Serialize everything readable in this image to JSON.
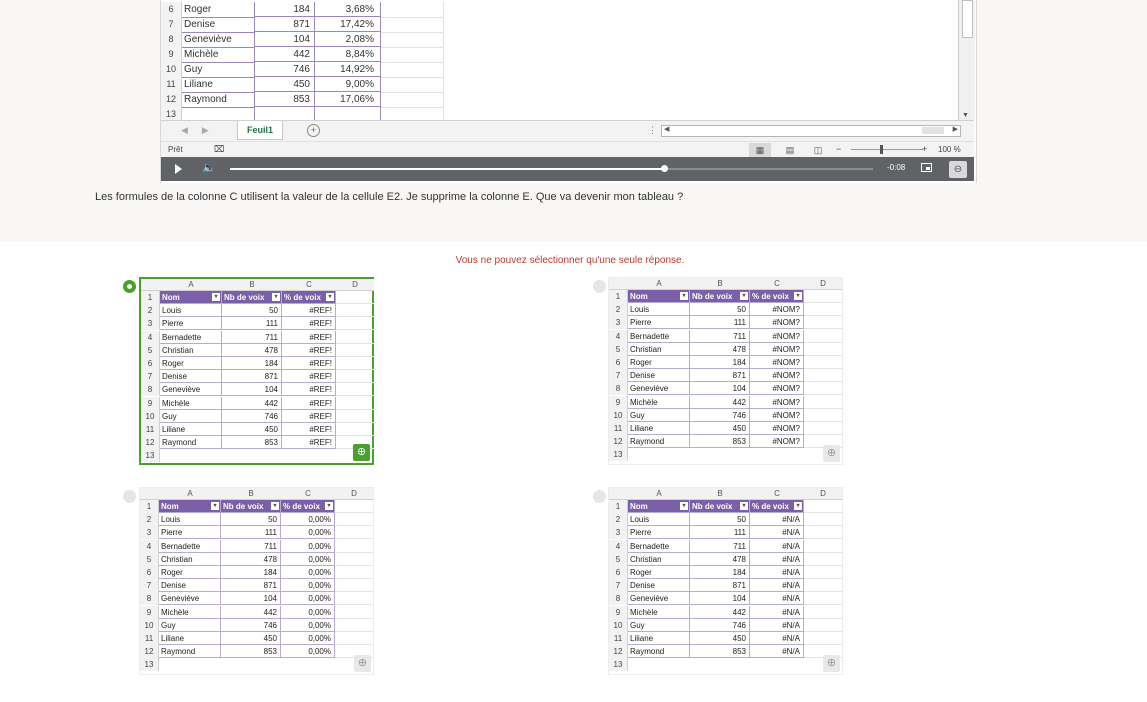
{
  "video": {
    "rows": [
      {
        "n": "6",
        "name": "Roger",
        "votes": "184",
        "pct": "3,68%"
      },
      {
        "n": "7",
        "name": "Denise",
        "votes": "871",
        "pct": "17,42%"
      },
      {
        "n": "8",
        "name": "Geneviève",
        "votes": "104",
        "pct": "2,08%"
      },
      {
        "n": "9",
        "name": "Michèle",
        "votes": "442",
        "pct": "8,84%"
      },
      {
        "n": "10",
        "name": "Guy",
        "votes": "746",
        "pct": "14,92%"
      },
      {
        "n": "11",
        "name": "Liliane",
        "votes": "450",
        "pct": "9,00%"
      },
      {
        "n": "12",
        "name": "Raymond",
        "votes": "853",
        "pct": "17,06%"
      },
      {
        "n": "13",
        "name": "",
        "votes": "",
        "pct": ""
      }
    ],
    "sheet_tab": "Feuil1",
    "add_sheet": "+",
    "status_ready": "Prêt",
    "zoom_minus": "−",
    "zoom_plus": "+",
    "zoom_pct": "100 %",
    "time": "-0:08",
    "progress": 0.675
  },
  "question": "Les formules de la colonne C utilisent la valeur de la cellule E2. Je supprime la colonne E. Que va devenir mon tableau ?",
  "notice": "Vous ne pouvez sélectionner qu'une seule réponse.",
  "options": [
    {
      "selected": true,
      "columns": [
        "A",
        "B",
        "C",
        "D"
      ],
      "headers": [
        "Nom",
        "Nb de voix",
        "% de voix"
      ],
      "rows": [
        [
          "Louis",
          "50",
          "#REF!"
        ],
        [
          "Pierre",
          "111",
          "#REF!"
        ],
        [
          "Bernadette",
          "711",
          "#REF!"
        ],
        [
          "Christian",
          "478",
          "#REF!"
        ],
        [
          "Roger",
          "184",
          "#REF!"
        ],
        [
          "Denise",
          "871",
          "#REF!"
        ],
        [
          "Geneviève",
          "104",
          "#REF!"
        ],
        [
          "Michèle",
          "442",
          "#REF!"
        ],
        [
          "Guy",
          "746",
          "#REF!"
        ],
        [
          "Liliane",
          "450",
          "#REF!"
        ],
        [
          "Raymond",
          "853",
          "#REF!"
        ]
      ]
    },
    {
      "selected": false,
      "columns": [
        "A",
        "B",
        "C",
        "D"
      ],
      "headers": [
        "Nom",
        "Nb de voix",
        "% de voix"
      ],
      "rows": [
        [
          "Louis",
          "50",
          "#NOM?"
        ],
        [
          "Pierre",
          "111",
          "#NOM?"
        ],
        [
          "Bernadette",
          "711",
          "#NOM?"
        ],
        [
          "Christian",
          "478",
          "#NOM?"
        ],
        [
          "Roger",
          "184",
          "#NOM?"
        ],
        [
          "Denise",
          "871",
          "#NOM?"
        ],
        [
          "Geneviève",
          "104",
          "#NOM?"
        ],
        [
          "Michèle",
          "442",
          "#NOM?"
        ],
        [
          "Guy",
          "746",
          "#NOM?"
        ],
        [
          "Liliane",
          "450",
          "#NOM?"
        ],
        [
          "Raymond",
          "853",
          "#NOM?"
        ]
      ]
    },
    {
      "selected": false,
      "columns": [
        "A",
        "B",
        "C",
        "D"
      ],
      "headers": [
        "Nom",
        "Nb de voix",
        "% de voix"
      ],
      "rows": [
        [
          "Louis",
          "50",
          "0,00%"
        ],
        [
          "Pierre",
          "111",
          "0,00%"
        ],
        [
          "Bernadette",
          "711",
          "0,00%"
        ],
        [
          "Christian",
          "478",
          "0,00%"
        ],
        [
          "Roger",
          "184",
          "0,00%"
        ],
        [
          "Denise",
          "871",
          "0,00%"
        ],
        [
          "Geneviève",
          "104",
          "0,00%"
        ],
        [
          "Michèle",
          "442",
          "0,00%"
        ],
        [
          "Guy",
          "746",
          "0,00%"
        ],
        [
          "Liliane",
          "450",
          "0,00%"
        ],
        [
          "Raymond",
          "853",
          "0,00%"
        ]
      ]
    },
    {
      "selected": false,
      "columns": [
        "A",
        "B",
        "C",
        "D"
      ],
      "headers": [
        "Nom",
        "Nb de voix",
        "% de voix"
      ],
      "rows": [
        [
          "Louis",
          "50",
          "#N/A"
        ],
        [
          "Pierre",
          "111",
          "#N/A"
        ],
        [
          "Bernadette",
          "711",
          "#N/A"
        ],
        [
          "Christian",
          "478",
          "#N/A"
        ],
        [
          "Roger",
          "184",
          "#N/A"
        ],
        [
          "Denise",
          "871",
          "#N/A"
        ],
        [
          "Geneviève",
          "104",
          "#N/A"
        ],
        [
          "Michèle",
          "442",
          "#N/A"
        ],
        [
          "Guy",
          "746",
          "#N/A"
        ],
        [
          "Liliane",
          "450",
          "#N/A"
        ],
        [
          "Raymond",
          "853",
          "#N/A"
        ]
      ]
    }
  ],
  "colors": {
    "accent": "#4aa02c",
    "header": "#7b5fa8",
    "notice": "#c0392b"
  }
}
